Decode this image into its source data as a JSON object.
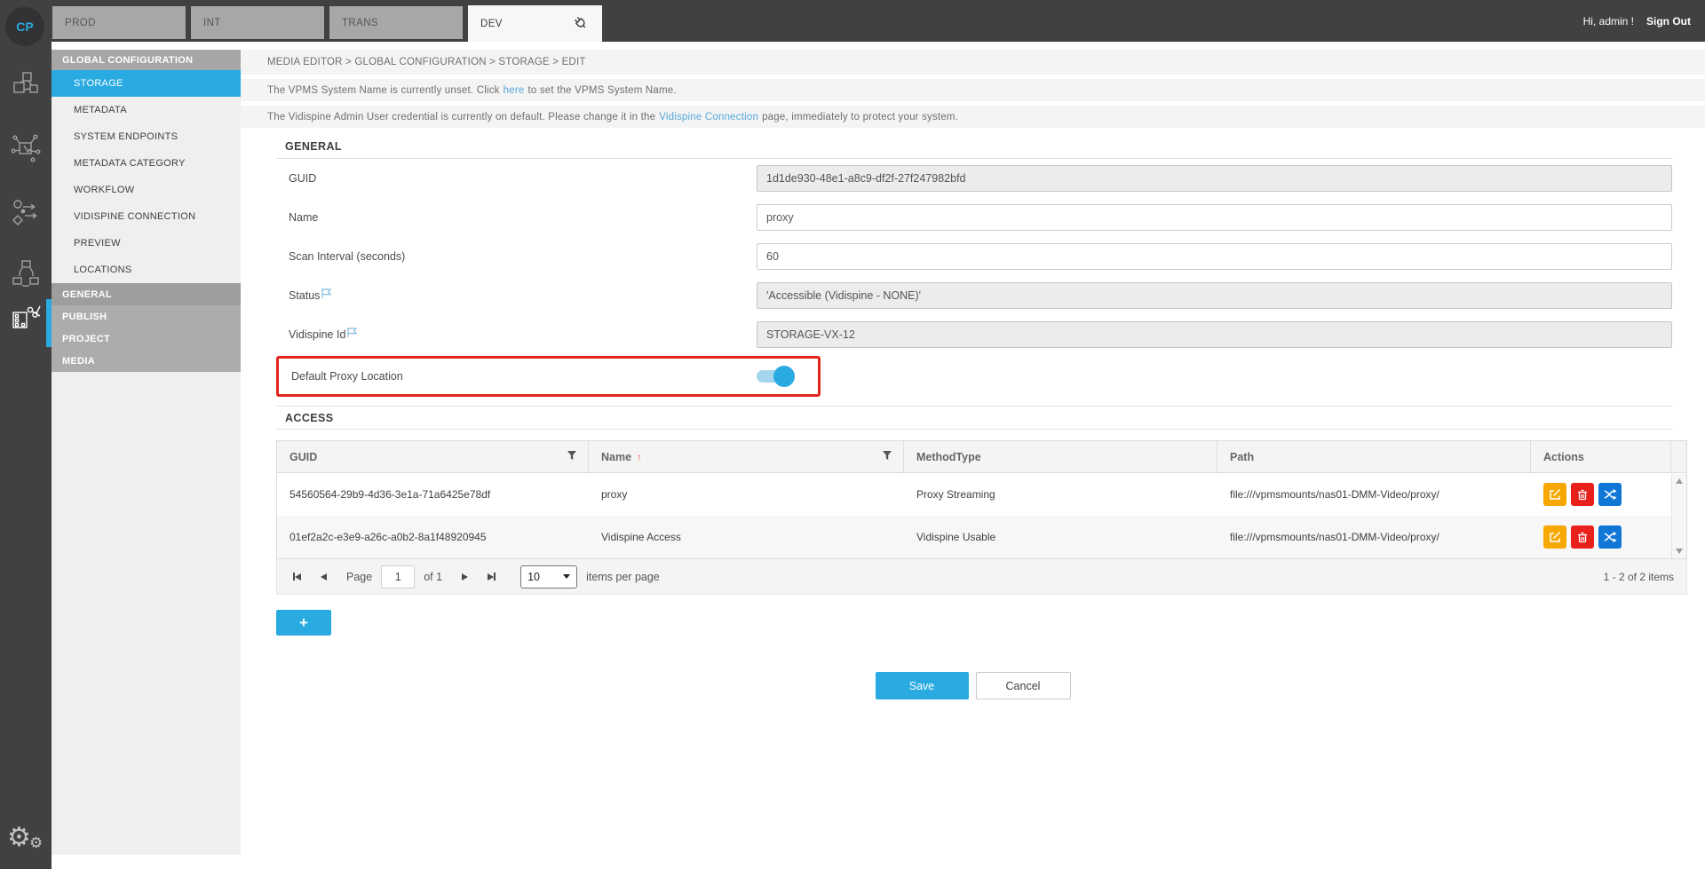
{
  "topbar": {
    "logo": "CP",
    "tabs": [
      "PROD",
      "INT",
      "TRANS",
      "DEV"
    ],
    "greeting": "Hi, admin !",
    "sign_out": "Sign Out"
  },
  "sidebar": {
    "config_header": "GLOBAL CONFIGURATION",
    "config_items": [
      "STORAGE",
      "METADATA",
      "SYSTEM ENDPOINTS",
      "METADATA CATEGORY",
      "WORKFLOW",
      "VIDISPINE CONNECTION",
      "PREVIEW",
      "LOCATIONS"
    ],
    "selected_item": "STORAGE",
    "module_items": [
      "GENERAL",
      "PUBLISH",
      "PROJECT",
      "MEDIA"
    ]
  },
  "breadcrumb": "MEDIA EDITOR > GLOBAL CONFIGURATION > STORAGE > EDIT",
  "notices": [
    {
      "pre": "The VPMS System Name is currently unset. Click",
      "link": "here",
      "post": "to set the VPMS System Name."
    },
    {
      "pre": "The Vidispine Admin User credential is currently on default. Please change it in the",
      "link": "Vidispine Connection",
      "post": "page, immediately to protect your system."
    }
  ],
  "general_section": {
    "title": "GENERAL",
    "fields": [
      {
        "label": "GUID",
        "value": "1d1de930-48e1-a8c9-df2f-27f247982bfd",
        "readonly": true
      },
      {
        "label": "Name",
        "value": "proxy",
        "readonly": false
      },
      {
        "label": "Scan Interval (seconds)",
        "value": "60",
        "readonly": false
      },
      {
        "label": "Status",
        "value": "'Accessible (Vidispine - NONE)'",
        "readonly": true
      },
      {
        "label": "Vidispine Id",
        "value": "STORAGE-VX-12",
        "readonly": true
      },
      {
        "label": "Default Proxy Location",
        "toggle_on": true,
        "highlighted": true
      }
    ]
  },
  "access_section": {
    "title": "ACCESS",
    "table": {
      "columns": [
        "GUID",
        "Name",
        "MethodType",
        "Path",
        "Actions"
      ],
      "rows": [
        {
          "guid": "54560564-29b9-4d36-3e1a-71a6425e78df",
          "name": "proxy",
          "method_type": "Proxy Streaming",
          "path": "file:///vpmsmounts/nas01-DMM-Video/proxy/"
        },
        {
          "guid": "01ef2a2c-e3e9-a26c-a0b2-8a1f48920945",
          "name": "Vidispine Access",
          "method_type": "Vidispine Usable",
          "path": "file:///vpmsmounts/nas01-DMM-Video/proxy/"
        }
      ]
    },
    "pagination": {
      "page_label": "Page",
      "page_value": "1",
      "of_label": "of 1",
      "page_size": "10",
      "per_page_label": "items per page",
      "range_label": "1 - 2 of 2 items"
    },
    "add_label": "+"
  },
  "footer": {
    "save": "Save",
    "cancel": "Cancel"
  },
  "colors": {
    "accent": "#29abe2",
    "topbar": "#414042",
    "highlight_border": "#e2251c",
    "edit_button": "#f7a800",
    "delete_button": "#e8211d",
    "shuffle_button": "#1177d7",
    "link": "#55a9de"
  }
}
